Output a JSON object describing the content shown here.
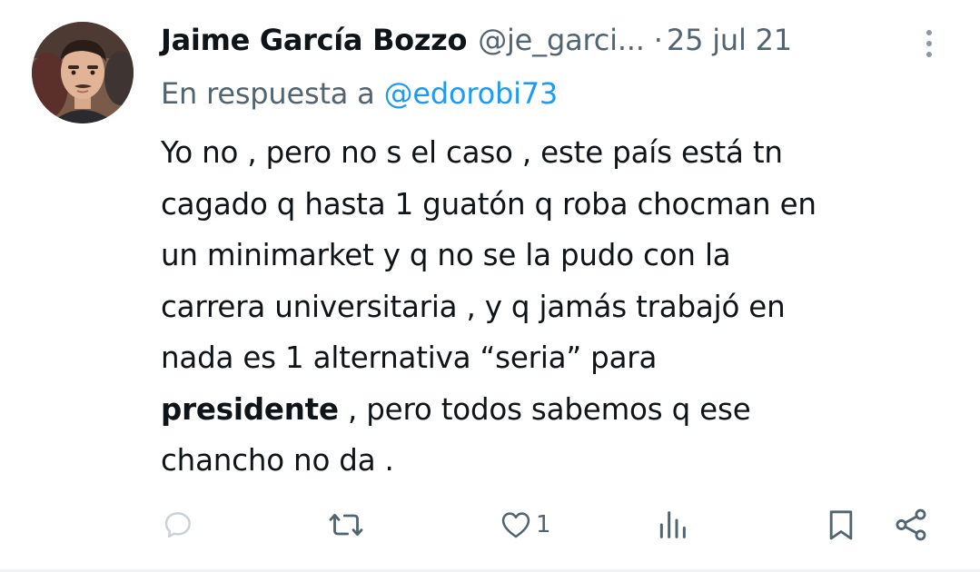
{
  "tweet": {
    "author_name": "Jaime García Bozzo",
    "handle": "@je_garci...",
    "separator": "·",
    "date": "25 jul 21",
    "reply_prefix": "En respuesta a ",
    "reply_mention": "@edorobi73",
    "text_line_1": "Yo no , pero no s el caso , este país está tn",
    "text_line_2": "cagado q hasta 1 guatón q roba chocman en",
    "text_line_3": "un minimarket y q no se la pudo con la",
    "text_line_4": "carrera universitaria , y q jamás trabajó en",
    "text_line_5": "nada es 1 alternativa “seria” para",
    "text_bold": "presidente",
    "text_line_6_rest": " , pero todos sabemos q ese",
    "text_line_7": "chancho no da ."
  },
  "actions": {
    "reply_icon": "comment-icon",
    "retweet_icon": "retweet-icon",
    "like_icon": "heart-icon",
    "like_count": "1",
    "views_icon": "views-icon",
    "bookmark_icon": "bookmark-icon",
    "share_icon": "share-icon"
  },
  "colors": {
    "text": "#0f1419",
    "secondary": "#536471",
    "accent": "#1d9bf0"
  }
}
